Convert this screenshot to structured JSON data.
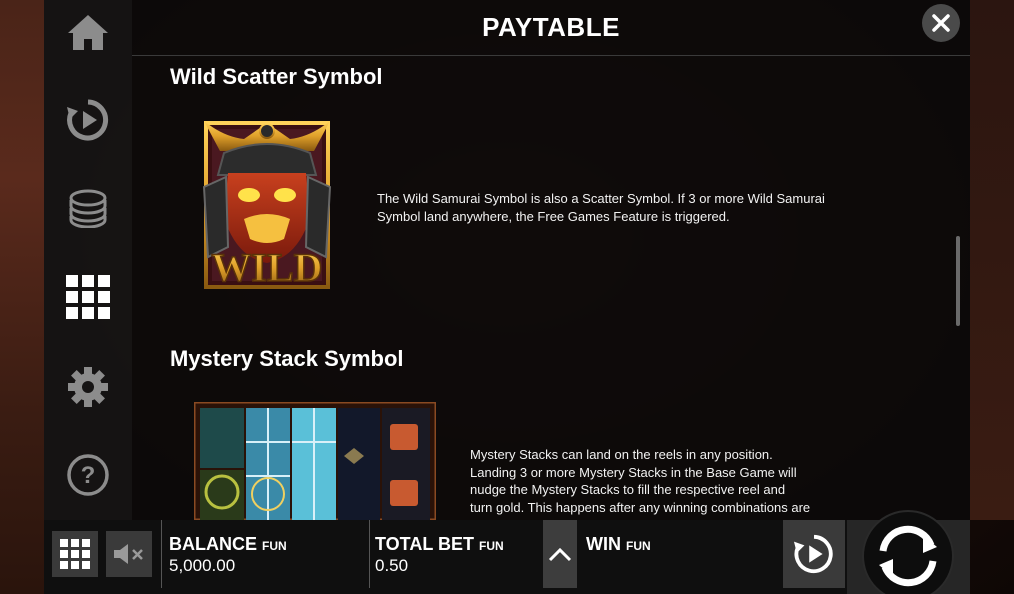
{
  "header": {
    "title": "PAYTABLE",
    "close_icon": "close-icon"
  },
  "sidebar": {
    "items": [
      {
        "name": "home",
        "icon": "home-icon"
      },
      {
        "name": "autoplay",
        "icon": "autoplay-icon"
      },
      {
        "name": "bet",
        "icon": "coins-icon"
      },
      {
        "name": "paytable",
        "icon": "grid-icon",
        "active": true
      },
      {
        "name": "settings",
        "icon": "gear-icon"
      },
      {
        "name": "help",
        "icon": "help-icon"
      }
    ]
  },
  "sections": [
    {
      "title": "Wild Scatter Symbol",
      "symbol_icon": "wild-samurai-icon",
      "symbol_text": "WILD",
      "description": "The Wild Samurai Symbol is also a Scatter Symbol. If 3 or more Wild Samurai Symbol land anywhere, the Free Games Feature is triggered."
    },
    {
      "title": "Mystery Stack Symbol",
      "symbol_icon": "mystery-stack-reels-image",
      "description_lines": [
        "Mystery Stacks can land on the reels in any position.",
        "Landing 3 or more Mystery Stacks in the Base Game will",
        "nudge the Mystery Stacks to fill the respective reel and",
        "turn gold. This happens after any winning combinations are"
      ]
    }
  ],
  "bottom_bar": {
    "menu_icon": "grid-menu-icon",
    "sound_icon": "sound-muted-icon",
    "balance": {
      "label": "BALANCE",
      "tag": "FUN",
      "value": "5,000.00"
    },
    "total_bet": {
      "label": "TOTAL BET",
      "tag": "FUN",
      "value": "0.50"
    },
    "bet_up_icon": "chevron-up-icon",
    "win": {
      "label": "WIN",
      "tag": "FUN",
      "value": ""
    },
    "autoplay_icon": "autoplay-icon",
    "spin_icon": "spin-icon"
  },
  "colors": {
    "panel_bg": "#0c0a0a",
    "sidebar_bg": "#161414",
    "button_bg": "#3a3a3a",
    "gold": "#e0a02a",
    "text": "#ffffff"
  }
}
